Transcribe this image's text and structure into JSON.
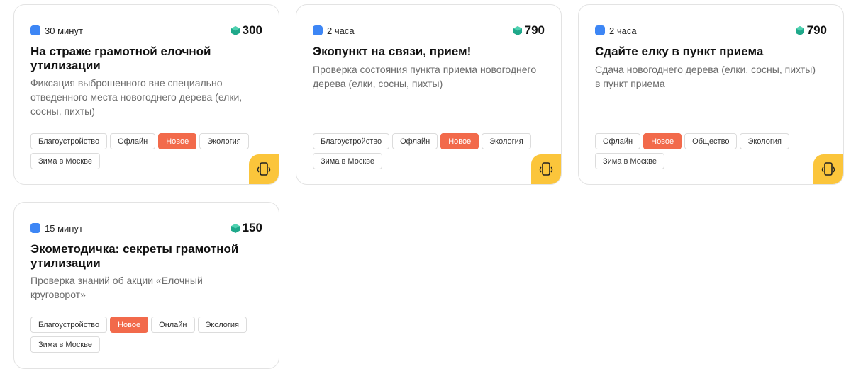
{
  "colors": {
    "accent_new": "#f26a4b",
    "corner": "#fbc53b",
    "duration_icon": "#3d86f5",
    "gem": "#1fa88a"
  },
  "icons": {
    "duration": "blue-square-icon",
    "points": "green-gem-icon",
    "corner": "phone-icon"
  },
  "cards": [
    {
      "duration": "30 минут",
      "points": "300",
      "title": "На страже грамотной елочной утилизации",
      "description": "Фиксация выброшенного вне специально отведенного места новогоднего дерева (елки, сосны, пихты)",
      "tags": [
        "Благоустройство",
        "Офлайн",
        "Новое",
        "Экология",
        "Зима в Москве"
      ]
    },
    {
      "duration": "2 часа",
      "points": "790",
      "title": "Экопункт на связи, прием!",
      "description": "Проверка состояния пункта приема новогоднего дерева (елки, сосны, пихты)",
      "tags": [
        "Благоустройство",
        "Офлайн",
        "Новое",
        "Экология",
        "Зима в Москве"
      ]
    },
    {
      "duration": "2 часа",
      "points": "790",
      "title": "Сдайте елку в пункт приема",
      "description": "Сдача новогоднего дерева (елки, сосны, пихты) в пункт приема",
      "tags": [
        "Офлайн",
        "Новое",
        "Общество",
        "Экология",
        "Зима в Москве"
      ]
    },
    {
      "duration": "15 минут",
      "points": "150",
      "title": "Экометодичка: секреты грамотной утилизации",
      "description": "Проверка знаний об акции «Елочный круговорот»",
      "tags": [
        "Благоустройство",
        "Новое",
        "Онлайн",
        "Экология",
        "Зима в Москве"
      ]
    }
  ]
}
